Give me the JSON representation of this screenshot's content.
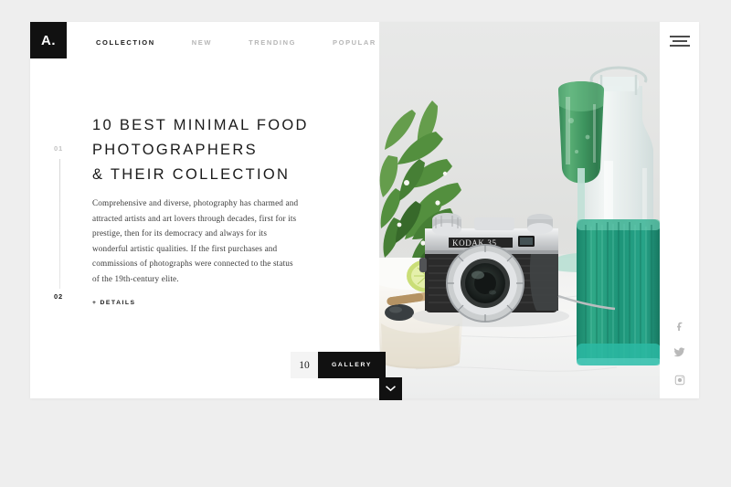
{
  "brand": {
    "logo_text": "A.",
    "logo_icon": "brand-mark"
  },
  "nav": {
    "items": [
      {
        "label": "COLLECTION",
        "active": true
      },
      {
        "label": "NEW",
        "active": false
      },
      {
        "label": "TRENDING",
        "active": false
      },
      {
        "label": "POPULAR",
        "active": false
      }
    ]
  },
  "hero": {
    "headline_lines": [
      "10 BEST MINIMAL FOOD",
      "PHOTOGRAPHERS",
      "& THEIR COLLECTION"
    ],
    "body": "Comprehensive and diverse, photography has charmed and attracted artists and art lovers through decades, first for its prestige, then for its democracy and always for its wonderful artistic qualities. If the first purchases and commissions of photographs were connected to the status of the 19th-century elite.",
    "details_plus": "+",
    "details_label": "DETAILS"
  },
  "slider": {
    "current": "01",
    "total": "02"
  },
  "gallery": {
    "count": "10",
    "button_label": "GALLERY",
    "scroll_icon": "chevron-down-icon"
  },
  "menu": {
    "icon": "hamburger-menu-icon"
  },
  "social": {
    "items": [
      {
        "name": "facebook-icon",
        "label": "Facebook"
      },
      {
        "name": "twitter-icon",
        "label": "Twitter"
      },
      {
        "name": "instagram-icon",
        "label": "Instagram"
      }
    ]
  },
  "photo": {
    "alt": "Vintage Kodak 35 camera on a white marble surface with a green smoothie in a ribbed glass, a glass bottle, potted herb plant and a lime wedge",
    "colors": {
      "background_wall": "#e4e5e4",
      "marble": "#f2f2f1",
      "smoothie_green": "#2f8f55",
      "glass_teal": "#1f9e7e",
      "plant_green": "#4f8c3b",
      "camera_body": "#2a2a2a",
      "camera_chrome": "#d9dadb"
    }
  },
  "theme": {
    "page_background": "#eeeeee",
    "card_background": "#ffffff",
    "accent_dark": "#111111",
    "muted_text": "#b6b6b6"
  }
}
